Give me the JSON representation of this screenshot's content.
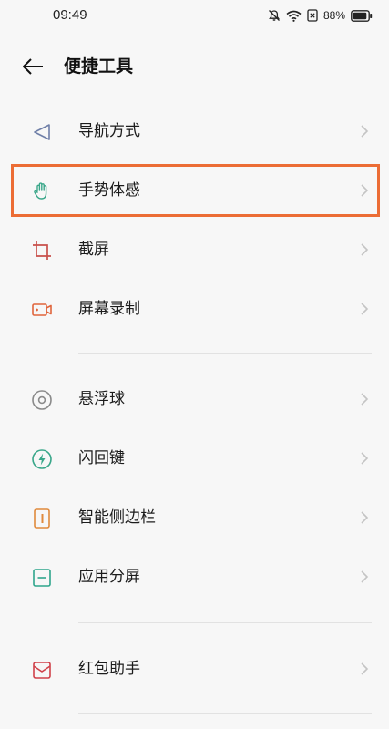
{
  "status_bar": {
    "time": "09:49",
    "battery_percent": "88%",
    "icons": [
      "bell-off-icon",
      "wifi-icon",
      "sim-icon",
      "battery-icon"
    ]
  },
  "header": {
    "title": "便捷工具",
    "back_icon": "back-arrow-icon"
  },
  "items": [
    {
      "label": "导航方式",
      "icon": "navigation-triangle-icon",
      "color": "#6f7fa8"
    },
    {
      "label": "手势体感",
      "icon": "hand-gesture-icon",
      "color": "#3aa78a",
      "highlighted": true
    },
    {
      "label": "截屏",
      "icon": "crop-screenshot-icon",
      "color": "#c8504b"
    },
    {
      "label": "屏幕录制",
      "icon": "screen-record-icon",
      "color": "#e0653c"
    },
    {
      "label": "悬浮球",
      "icon": "floating-ball-icon",
      "color": "#8a8a8a"
    },
    {
      "label": "闪回键",
      "icon": "flash-back-icon",
      "color": "#3aa78a"
    },
    {
      "label": "智能侧边栏",
      "icon": "smart-sidebar-icon",
      "color": "#e08a3c"
    },
    {
      "label": "应用分屏",
      "icon": "split-screen-icon",
      "color": "#2fa58c"
    },
    {
      "label": "红包助手",
      "icon": "red-envelope-icon",
      "color": "#d0414a"
    }
  ],
  "colors": {
    "highlight_border": "#ec6d35",
    "chevron": "#c4c4c4",
    "divider": "#e2e2e2",
    "background": "#f7f7f7"
  }
}
